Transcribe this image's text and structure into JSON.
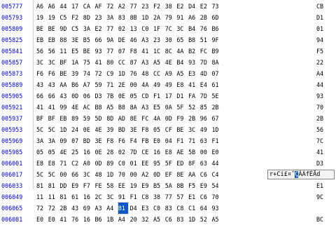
{
  "colors": {
    "address": "#0000ee",
    "selection": "#0a58c7",
    "background": "#ffffff"
  },
  "rows": [
    {
      "addr": "005777",
      "bytes": [
        "A6",
        "A6",
        "44",
        "17",
        "CA",
        "AF",
        "72",
        "A2",
        "77",
        "23",
        "F2",
        "38",
        "E2",
        "D4",
        "E2",
        "73"
      ],
      "right": "CB"
    },
    {
      "addr": "005793",
      "bytes": [
        "19",
        "19",
        "C5",
        "F2",
        "8D",
        "23",
        "3A",
        "83",
        "8B",
        "1D",
        "2A",
        "79",
        "91",
        "A6",
        "2B",
        "6D"
      ],
      "right": "D1"
    },
    {
      "addr": "005809",
      "bytes": [
        "BE",
        "BE",
        "9D",
        "C5",
        "3A",
        "E2",
        "77",
        "02",
        "13",
        "C0",
        "1F",
        "7C",
        "3C",
        "B4",
        "76",
        "B6"
      ],
      "right": "01"
    },
    {
      "addr": "005825",
      "bytes": [
        "EB",
        "EB",
        "88",
        "3E",
        "B5",
        "66",
        "9A",
        "DE",
        "46",
        "A3",
        "23",
        "30",
        "65",
        "B8",
        "51",
        "9F"
      ],
      "right": "94"
    },
    {
      "addr": "005841",
      "bytes": [
        "56",
        "56",
        "11",
        "E5",
        "BE",
        "93",
        "77",
        "07",
        "F8",
        "41",
        "1C",
        "8C",
        "4A",
        "B2",
        "FC",
        "B9"
      ],
      "right": "F5"
    },
    {
      "addr": "005857",
      "bytes": [
        "3C",
        "3C",
        "BF",
        "1A",
        "75",
        "41",
        "80",
        "CC",
        "87",
        "A3",
        "A5",
        "4E",
        "B4",
        "93",
        "7D",
        "8A"
      ],
      "right": "22"
    },
    {
      "addr": "005873",
      "bytes": [
        "F6",
        "F6",
        "BE",
        "39",
        "74",
        "72",
        "C9",
        "1D",
        "76",
        "48",
        "CC",
        "A9",
        "A5",
        "E3",
        "4D",
        "07"
      ],
      "right": "A4"
    },
    {
      "addr": "005889",
      "bytes": [
        "43",
        "43",
        "AA",
        "B6",
        "A7",
        "59",
        "71",
        "2E",
        "00",
        "4A",
        "49",
        "49",
        "E8",
        "41",
        "E4",
        "61"
      ],
      "right": "44"
    },
    {
      "addr": "005905",
      "bytes": [
        "66",
        "66",
        "43",
        "0D",
        "06",
        "D3",
        "7B",
        "0E",
        "05",
        "CD",
        "F1",
        "17",
        "D1",
        "FA",
        "7D",
        "5E"
      ],
      "right": "93"
    },
    {
      "addr": "005921",
      "bytes": [
        "41",
        "41",
        "99",
        "4E",
        "AC",
        "B8",
        "A5",
        "B8",
        "8A",
        "A3",
        "E5",
        "0A",
        "5F",
        "52",
        "85",
        "2B"
      ],
      "right": "70"
    },
    {
      "addr": "005937",
      "bytes": [
        "BF",
        "BF",
        "EB",
        "89",
        "59",
        "5D",
        "8D",
        "AD",
        "8E",
        "FC",
        "4A",
        "0D",
        "F9",
        "2B",
        "96",
        "67"
      ],
      "right": "2B"
    },
    {
      "addr": "005953",
      "bytes": [
        "5C",
        "5C",
        "1D",
        "24",
        "0E",
        "4E",
        "39",
        "BD",
        "3E",
        "F8",
        "05",
        "CF",
        "BE",
        "3C",
        "49",
        "1D"
      ],
      "right": "56"
    },
    {
      "addr": "005969",
      "bytes": [
        "3A",
        "3A",
        "09",
        "07",
        "BD",
        "3E",
        "F8",
        "F6",
        "F4",
        "FB",
        "E0",
        "04",
        "F1",
        "71",
        "63",
        "F1"
      ],
      "right": "7C"
    },
    {
      "addr": "005985",
      "bytes": [
        "05",
        "05",
        "4E",
        "25",
        "16",
        "0E",
        "28",
        "02",
        "7D",
        "CE",
        "16",
        "E8",
        "AE",
        "5B",
        "00",
        "E0"
      ],
      "right": "41"
    },
    {
      "addr": "006001",
      "bytes": [
        "E8",
        "E8",
        "71",
        "C2",
        "A0",
        "0D",
        "89",
        "C0",
        "01",
        "EE",
        "95",
        "5F",
        "ED",
        "8F",
        "63",
        "44"
      ],
      "right": "D3"
    },
    {
      "addr": "006017",
      "bytes": [
        "5C",
        "5C",
        "00",
        "66",
        "3C",
        "48",
        "1D",
        "70",
        "00",
        "A2",
        "0D",
        "EF",
        "8E",
        "AA",
        "C6",
        "C4"
      ],
      "right": "E1"
    },
    {
      "addr": "006033",
      "bytes": [
        "81",
        "81",
        "DD",
        "E9",
        "F7",
        "FE",
        "58",
        "EE",
        "19",
        "E9",
        "B5",
        "5A",
        "8B",
        "F5",
        "E9",
        "54"
      ],
      "right": "E1"
    },
    {
      "addr": "006049",
      "bytes": [
        "11",
        "11",
        "81",
        "61",
        "16",
        "2C",
        "3C",
        "91",
        "F1",
        "C8",
        "38",
        "77",
        "57",
        "E1",
        "C6",
        "70"
      ],
      "right": "9C"
    },
    {
      "addr": "006065",
      "bytes": [
        "72",
        "72",
        "2B",
        "43",
        "69",
        "A3",
        "A4",
        "81",
        "D4",
        "E3",
        "C0",
        "83",
        "C8",
        "C1",
        "64",
        "93"
      ],
      "right": ""
    },
    {
      "addr": "006081",
      "bytes": [
        "E0",
        "E0",
        "41",
        "76",
        "16",
        "B6",
        "1B",
        "A4",
        "20",
        "32",
        "A5",
        "C6",
        "83",
        "1D",
        "52",
        "A5"
      ],
      "right": "BC"
    }
  ],
  "selected": {
    "row": 18,
    "col": 7,
    "value": "81"
  },
  "tooltip": {
    "prefix": "r+Ci£¤ˆ",
    "highlight": "Ç",
    "suffix": "ÃÁfÉÄd"
  }
}
